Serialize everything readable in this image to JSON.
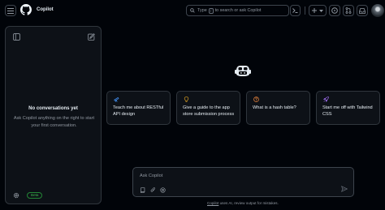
{
  "header": {
    "app_title": "Copilot",
    "search": {
      "text_before_key": "Type",
      "key": "/",
      "text_after_key": "to search or ask Copilot"
    }
  },
  "sidebar": {
    "empty_title": "No conversations yet",
    "empty_description": "Ask Copilot anything on the right to start your first conversation.",
    "beta_badge": "Beta"
  },
  "suggestions": [
    {
      "icon": "telescope-icon",
      "color": "#4493f8",
      "text": "Teach me about RESTful API design"
    },
    {
      "icon": "lightbulb-icon",
      "color": "#d29922",
      "text": "Give a guide to the app store submission process"
    },
    {
      "icon": "question-icon",
      "color": "#f0883e",
      "text": "What is a hash table?"
    },
    {
      "icon": "rocket-icon",
      "color": "#a371f7",
      "text": "Start me off with Tailwind CSS"
    }
  ],
  "composer": {
    "placeholder": "Ask Copilot"
  },
  "footer": {
    "link_text": "Copilot",
    "note_text": " uses AI, review output for mistakes."
  },
  "colors": {
    "background": "#010409",
    "panel": "#0d1117",
    "border": "#30363d",
    "text": "#e6edf3",
    "muted": "#9198a1",
    "beta_green": "#3fb950"
  }
}
